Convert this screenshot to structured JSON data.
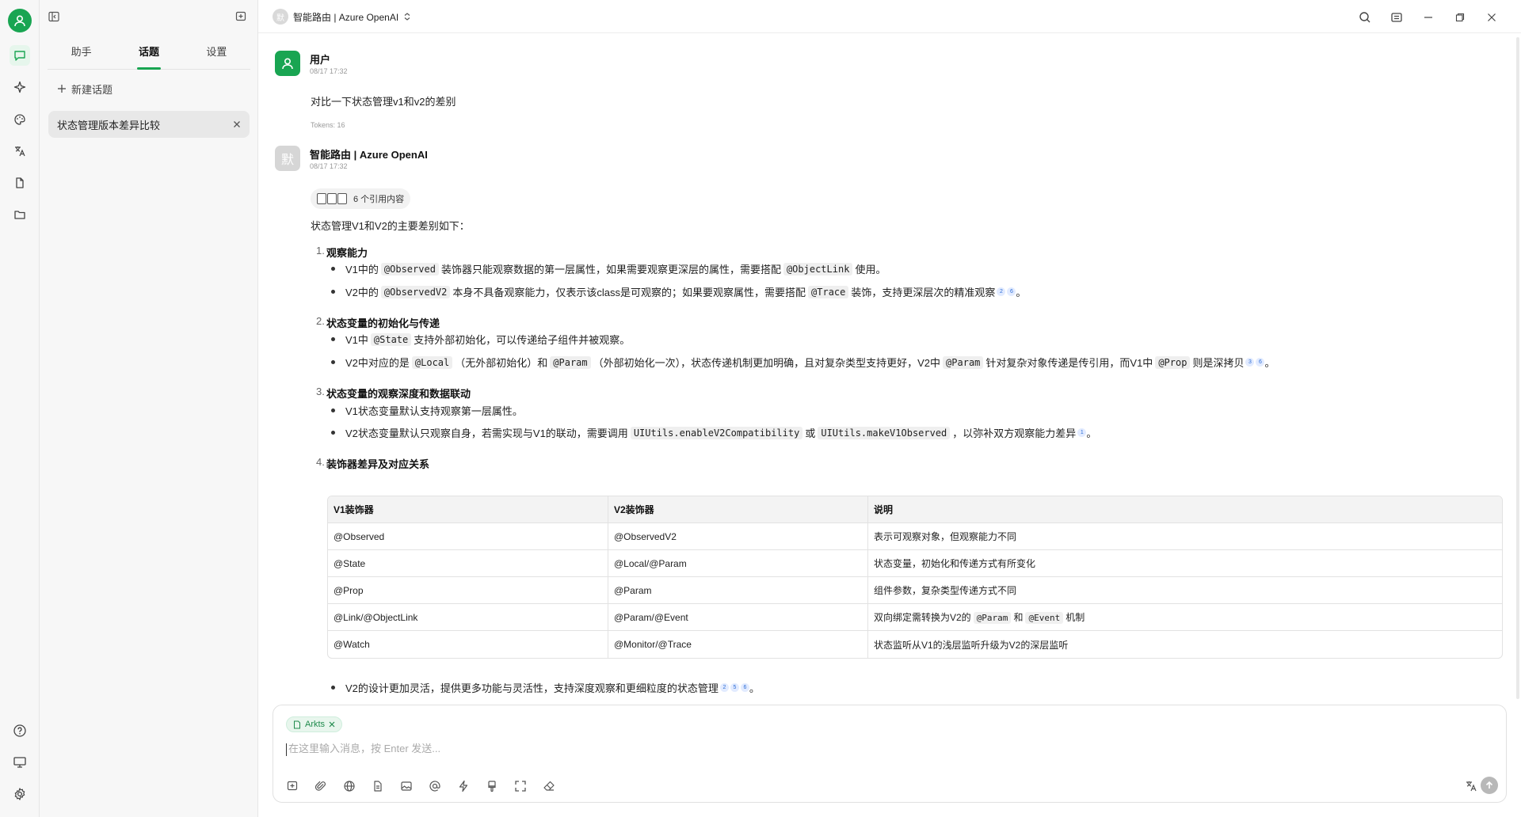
{
  "colors": {
    "accent": "#19a552",
    "sidebar_bg": "#f7f7f7"
  },
  "rail": {
    "icons": [
      "user-avatar-icon",
      "chat-icon",
      "sparkle-icon",
      "palette-icon",
      "translate-icon",
      "document-icon",
      "folder-icon",
      "help-icon",
      "monitor-icon",
      "settings-icon"
    ]
  },
  "panel": {
    "tabs": [
      "助手",
      "话题",
      "设置"
    ],
    "active_tab": "话题",
    "new_topic_label": "新建话题",
    "topics": [
      {
        "title": "状态管理版本差异比较"
      }
    ]
  },
  "header": {
    "model_avatar": "默",
    "model_name": "智能路由 | Azure OpenAI"
  },
  "chat": {
    "user_message": {
      "name": "用户",
      "time": "08/17 17:32",
      "text": "对比一下状态管理v1和v2的差别",
      "tokens": "Tokens: 16"
    },
    "assistant_message": {
      "avatar": "默",
      "name": "智能路由 | Azure OpenAI",
      "time": "08/17 17:32",
      "citations_label": "6 个引用内容",
      "intro": "状态管理V1和V2的主要差别如下：",
      "sections": [
        {
          "num": "1.",
          "title": "观察能力",
          "items": [
            {
              "parts": [
                "V1中的",
                "@Observed",
                "装饰器只能观察数据的第一层属性，如果需要观察更深层的属性，需要搭配",
                "@ObjectLink",
                "使用。"
              ]
            },
            {
              "parts": [
                "V2中的",
                "@ObservedV2",
                "本身不具备观察能力，仅表示该class是可观察的；如果要观察属性，需要搭配",
                "@Trace",
                "装饰，支持更深层次的精准观察"
              ],
              "refs": [
                "2",
                "6"
              ],
              "end": "。"
            }
          ]
        },
        {
          "num": "2.",
          "title": "状态变量的初始化与传递",
          "items": [
            {
              "parts": [
                "V1中",
                "@State",
                "支持外部初始化，可以传递给子组件并被观察。"
              ]
            },
            {
              "parts": [
                "V2中对应的是",
                "@Local",
                "（无外部初始化）和",
                "@Param",
                "（外部初始化一次），状态传递机制更加明确，且对复杂类型支持更好，V2中",
                "@Param",
                "针对复杂对象传递是传引用，而V1中",
                "@Prop",
                "则是深拷贝"
              ],
              "refs": [
                "3",
                "6"
              ],
              "end": "。"
            }
          ]
        },
        {
          "num": "3.",
          "title": "状态变量的观察深度和数据联动",
          "items": [
            {
              "parts": [
                "V1状态变量默认支持观察第一层属性。"
              ]
            },
            {
              "parts": [
                "V2状态变量默认只观察自身，若需实现与V1的联动，需要调用",
                "UIUtils.enableV2Compatibility",
                "或",
                "UIUtils.makeV1Observed",
                "，以弥补双方观察能力差异"
              ],
              "refs": [
                "1"
              ],
              "end": "。"
            }
          ]
        },
        {
          "num": "4.",
          "title": "装饰器差异及对应关系"
        }
      ],
      "table": {
        "headers": [
          "V1装饰器",
          "V2装饰器",
          "说明"
        ],
        "rows": [
          [
            "@Observed",
            "@ObservedV2",
            "表示可观察对象，但观察能力不同"
          ],
          [
            "@State",
            "@Local/@Param",
            "状态变量，初始化和传递方式有所变化"
          ],
          [
            "@Prop",
            "@Param",
            "组件参数，复杂类型传递方式不同"
          ],
          [
            "@Link/@ObjectLink",
            "@Param/@Event",
            "双向绑定需转换为V2的 @Param 和 @Event 机制"
          ],
          [
            "@Watch",
            "@Monitor/@Trace",
            "状态监听从V1的浅层监听升级为V2的深层监听"
          ]
        ],
        "row4_note": {
          "pre": "双向绑定需转换为V2的",
          "c1": "@Param",
          "mid": "和",
          "c2": "@Event",
          "post": "机制"
        }
      },
      "summary": {
        "text": "V2的设计更加灵活，提供更多功能与灵活性，支持深度观察和更细粒度的状态管理",
        "refs": [
          "2",
          "5",
          "6"
        ],
        "end": "。"
      }
    }
  },
  "input": {
    "knowledge_chip": "Arkts",
    "placeholder": "在这里输入消息，按 Enter 发送...",
    "tools": [
      "new-topic-icon",
      "attach-icon",
      "web-search-icon",
      "knowledge-icon",
      "image-icon",
      "mention-icon",
      "lightning-icon",
      "brush-icon",
      "expand-icon",
      "clear-icon"
    ]
  }
}
